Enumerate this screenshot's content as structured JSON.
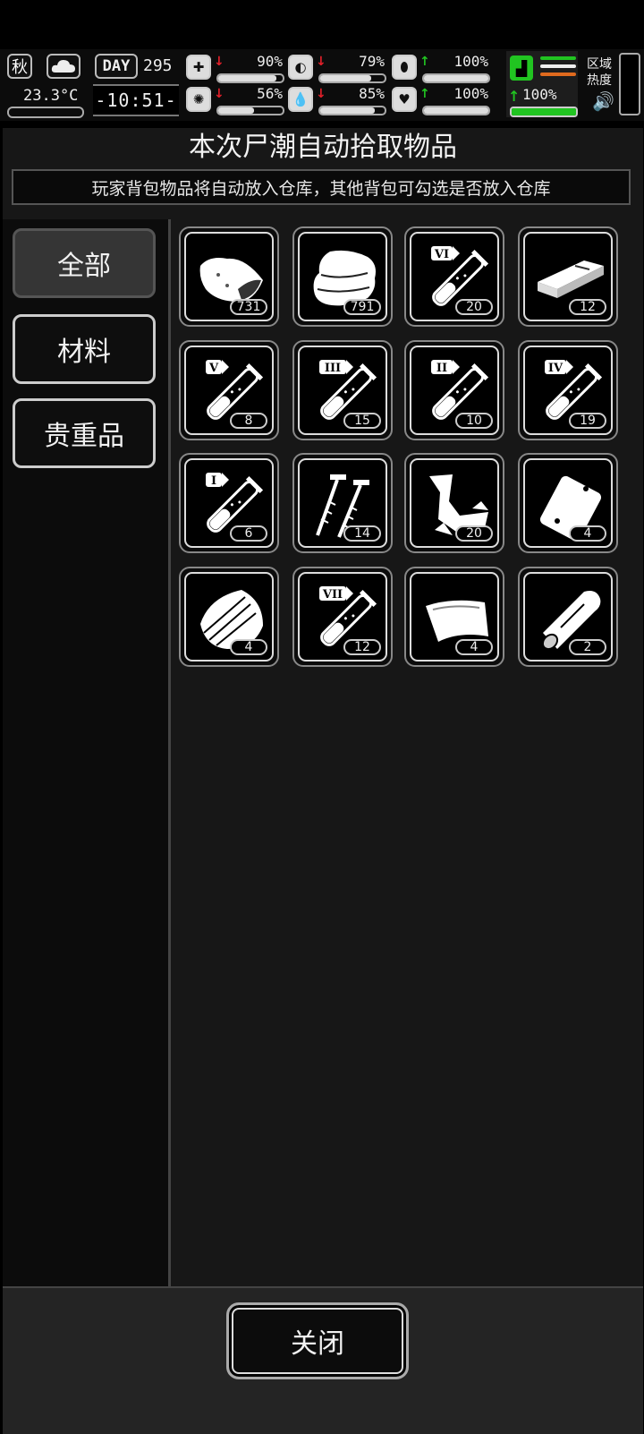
{
  "hud": {
    "season": "秋",
    "temperature": "23.3°C",
    "day_label": "DAY",
    "day_number": "295",
    "clock": "-10:51-",
    "stats": [
      {
        "icon": "medkit-icon",
        "glyph": "✚",
        "trend": "down",
        "value": "90%",
        "fill": 0.9
      },
      {
        "icon": "stomach-icon",
        "glyph": "◐",
        "trend": "down",
        "value": "79%",
        "fill": 0.79
      },
      {
        "icon": "pill-icon",
        "glyph": "⬮",
        "trend": "up",
        "value": "100%",
        "fill": 1.0
      },
      {
        "icon": "brain-icon",
        "glyph": "✺",
        "trend": "down",
        "value": "56%",
        "fill": 0.56
      },
      {
        "icon": "water-drop-icon",
        "glyph": "💧",
        "trend": "down",
        "value": "85%",
        "fill": 0.85
      },
      {
        "icon": "heart-icon",
        "glyph": "♥",
        "trend": "up",
        "value": "100%",
        "fill": 1.0
      }
    ],
    "stamina": {
      "value": "100%",
      "arrow": "↑"
    },
    "region_label": "区域热度",
    "speaker_glyph": "🔊",
    "arrows": {
      "up": "↑",
      "down": "↓"
    }
  },
  "colors": {
    "accent_green": "#21c421",
    "alert_red": "#e3202a",
    "stripe_orange": "#e06a1e"
  },
  "panel": {
    "title": "本次尸潮自动拾取物品",
    "subtitle": "玩家背包物品将自动放入仓库，其他背包可勾选是否放入仓库"
  },
  "categories": [
    {
      "label": "全部",
      "active": true
    },
    {
      "label": "材料",
      "active": false
    },
    {
      "label": "贵重品",
      "active": false
    }
  ],
  "items": [
    {
      "icon": "raw-meat-icon",
      "count": "731"
    },
    {
      "icon": "cloth-stack-icon",
      "count": "791"
    },
    {
      "icon": "test-tube-vi-icon",
      "tier": "VI",
      "count": "20"
    },
    {
      "icon": "wood-plank-icon",
      "count": "12"
    },
    {
      "icon": "test-tube-v-icon",
      "tier": "V",
      "count": "8"
    },
    {
      "icon": "test-tube-iii-icon",
      "tier": "III",
      "count": "15"
    },
    {
      "icon": "test-tube-ii-icon",
      "tier": "II",
      "count": "10"
    },
    {
      "icon": "test-tube-iv-icon",
      "tier": "IV",
      "count": "19"
    },
    {
      "icon": "test-tube-i-icon",
      "tier": "I",
      "count": "6"
    },
    {
      "icon": "screws-icon",
      "count": "14"
    },
    {
      "icon": "scrap-metal-icon",
      "count": "20"
    },
    {
      "icon": "bag-icon",
      "count": "4"
    },
    {
      "icon": "bark-icon",
      "count": "4"
    },
    {
      "icon": "test-tube-vii-icon",
      "tier": "VII",
      "count": "12"
    },
    {
      "icon": "glass-sheet-icon",
      "count": "4"
    },
    {
      "icon": "log-icon",
      "count": "2"
    }
  ],
  "footer": {
    "close_label": "关闭"
  }
}
